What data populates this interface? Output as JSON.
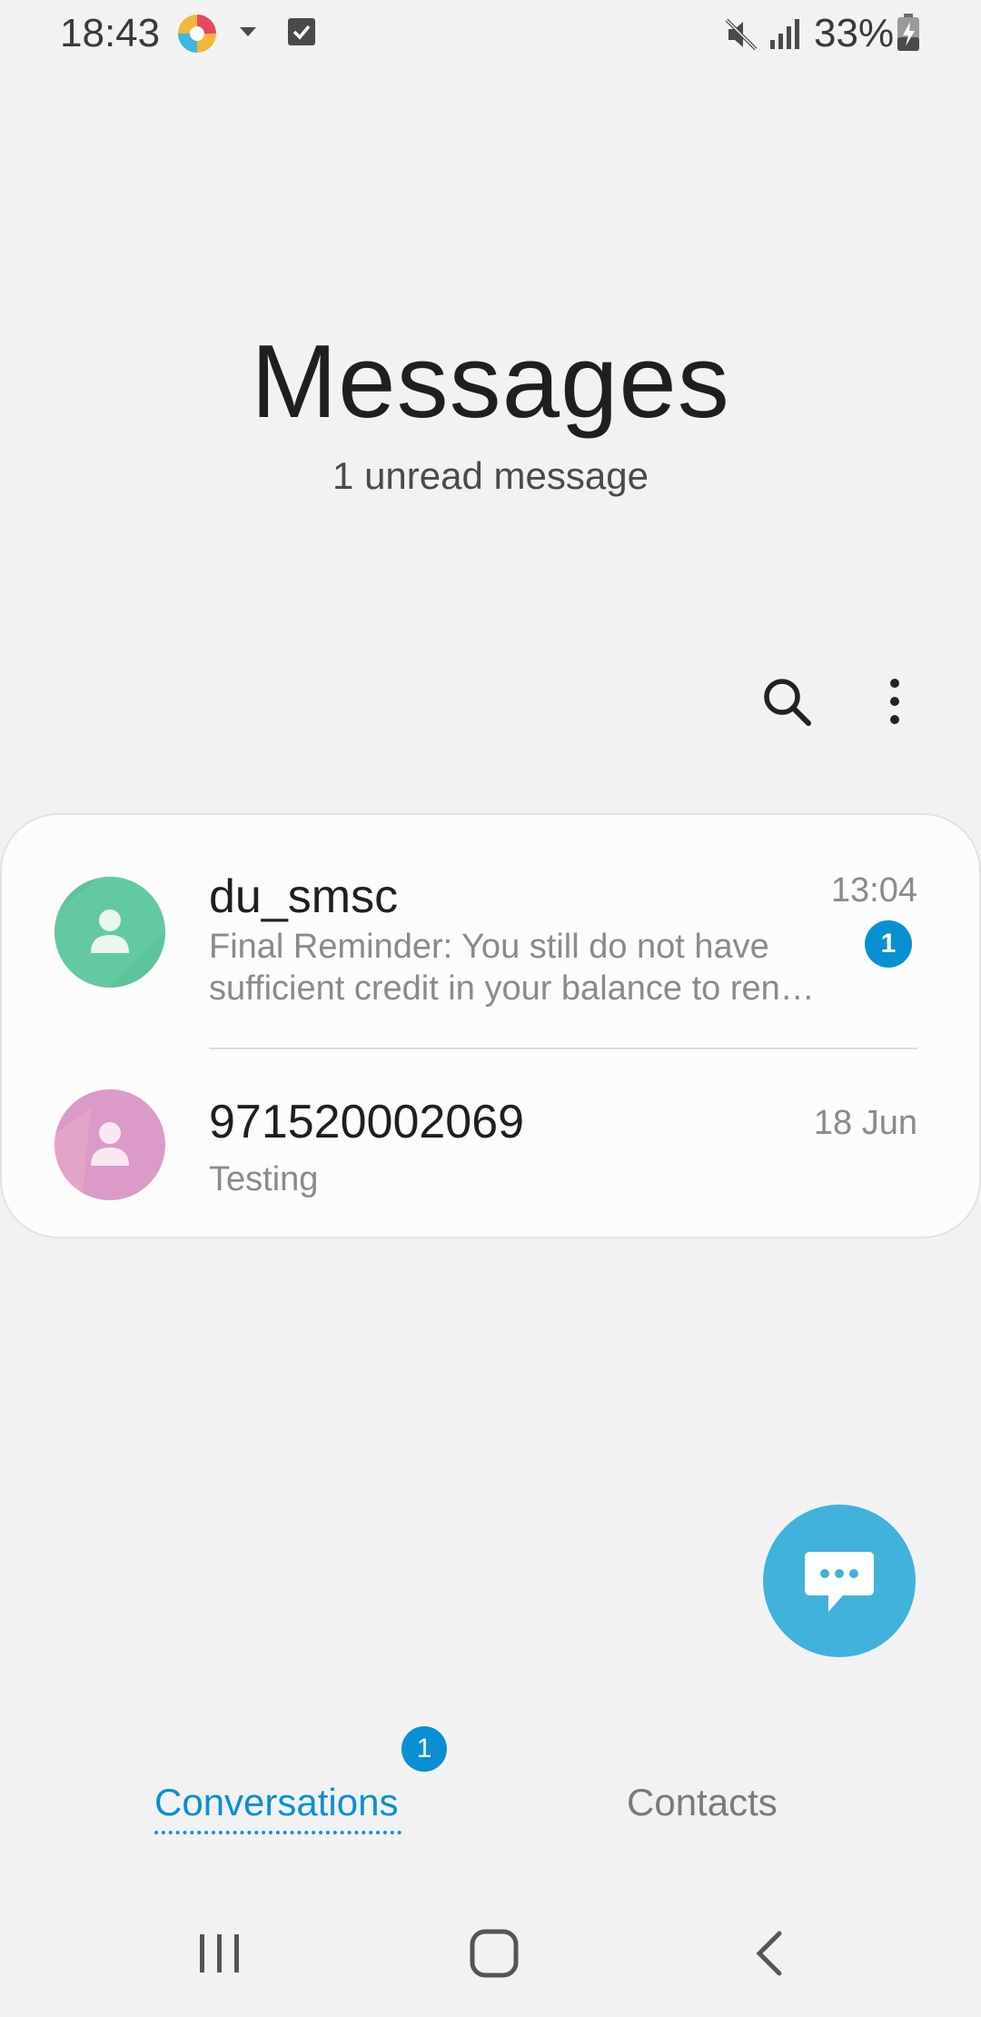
{
  "status_bar": {
    "time": "18:43",
    "battery_text": "33%",
    "icons": [
      "app-icon",
      "dropdown-caret-icon",
      "checkbox-icon",
      "mute-icon",
      "signal-icon",
      "battery-charging-icon"
    ]
  },
  "header": {
    "title": "Messages",
    "subtitle": "1 unread message"
  },
  "actions": {
    "search_icon": "search-icon",
    "more_icon": "more-vertical-icon"
  },
  "conversations": [
    {
      "name": "du_smsc",
      "preview": "Final Reminder: You still do not have sufficient credit in your balance to ren…",
      "time": "13:04",
      "unread_count": "1",
      "avatar_color": "#5cc39a"
    },
    {
      "name": "971520002069",
      "preview": "Testing",
      "time": "18 Jun",
      "avatar_color": "#dc9ac8"
    }
  ],
  "fab": {
    "icon": "compose-message-icon"
  },
  "tabs": {
    "conversations": {
      "label": "Conversations",
      "badge": "1"
    },
    "contacts": {
      "label": "Contacts"
    }
  },
  "nav_bar": {
    "icons": [
      "recents-icon",
      "home-icon",
      "back-icon"
    ]
  },
  "colors": {
    "accent": "#0a8fd2",
    "fab": "#41b2dc",
    "background": "#f2f2f2"
  }
}
